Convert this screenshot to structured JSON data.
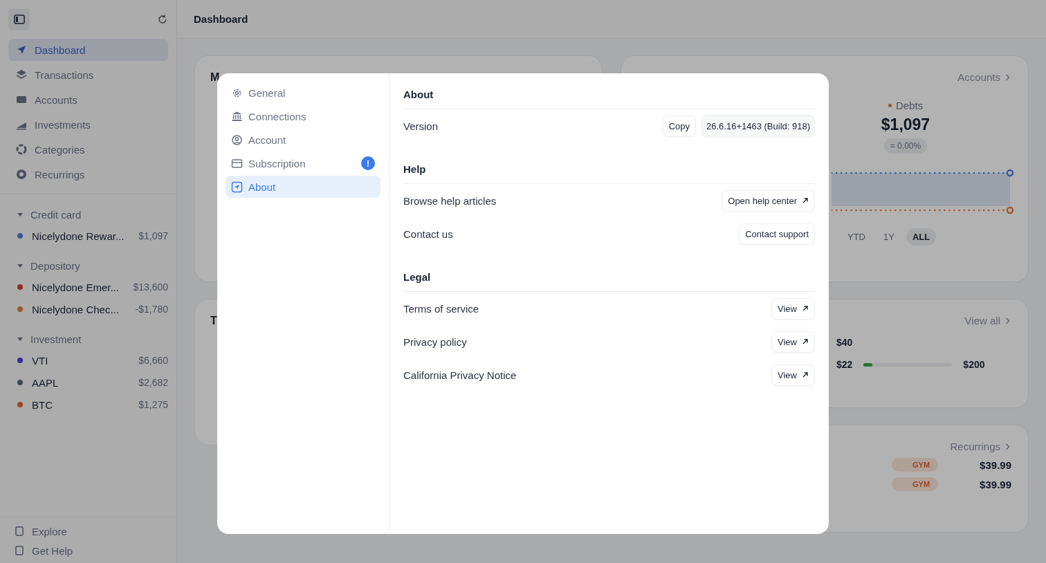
{
  "sidebar": {
    "nav": [
      {
        "label": "Dashboard",
        "selected": true
      },
      {
        "label": "Transactions",
        "selected": false
      },
      {
        "label": "Accounts",
        "selected": false
      },
      {
        "label": "Investments",
        "selected": false
      },
      {
        "label": "Categories",
        "selected": false
      },
      {
        "label": "Recurrings",
        "selected": false
      }
    ],
    "groups": [
      {
        "name": "Credit card",
        "expanded": true,
        "accounts": [
          {
            "name": "Nicelydone Rewar...",
            "amount": "$1,097",
            "color": "#34589d"
          }
        ]
      },
      {
        "name": "Depository",
        "expanded": true,
        "accounts": [
          {
            "name": "Nicelydone Emer...",
            "amount": "$13,600",
            "color": "#97281e"
          },
          {
            "name": "Nicelydone Chec...",
            "amount": "-$1,780",
            "color": "#9d5529"
          }
        ]
      },
      {
        "name": "Investment",
        "expanded": true,
        "accounts": [
          {
            "name": "VTI",
            "amount": "$6,660",
            "color": "#352c96"
          },
          {
            "name": "AAPL",
            "amount": "$2,682",
            "color": "#3f485a"
          },
          {
            "name": "BTC",
            "amount": "$1,275",
            "color": "#9d461e"
          }
        ]
      }
    ],
    "footer": [
      {
        "label": "Explore"
      },
      {
        "label": "Get Help"
      }
    ]
  },
  "header": {
    "title": "Dashboard"
  },
  "cards": {
    "left_titles": [
      "M",
      "T"
    ],
    "accounts_link": "Accounts",
    "debts": {
      "label": "Debts",
      "amount": "$1,097",
      "change": "= 0.00%"
    },
    "ranges": [
      {
        "label": "YTD",
        "selected": false
      },
      {
        "label": "1Y",
        "selected": false
      },
      {
        "label": "ALL",
        "selected": true
      }
    ],
    "budget_link": "View all",
    "budget": {
      "top": "$40",
      "spent": "$22",
      "level": 0.1,
      "limit": "$200"
    },
    "recurrings_link": "Recurrings",
    "recurrings": [
      {
        "tag": "GYM",
        "amount": "$39.99"
      },
      {
        "tag": "GYM",
        "amount": "$39.99"
      }
    ]
  },
  "settings_modal": {
    "nav": [
      {
        "label": "General",
        "selected": false
      },
      {
        "label": "Connections",
        "selected": false
      },
      {
        "label": "Account",
        "selected": false
      },
      {
        "label": "Subscription",
        "selected": false,
        "badge": "!"
      },
      {
        "label": "About",
        "selected": true
      }
    ],
    "sections": [
      {
        "title": "About",
        "rows": [
          {
            "label": "Version",
            "button": "Copy",
            "value": "26.6.16+1463 (Build: 918)",
            "external": false
          }
        ]
      },
      {
        "title": "Help",
        "rows": [
          {
            "label": "Browse help articles",
            "button": "Open help center",
            "external": true
          },
          {
            "label": "Contact us",
            "button": "Contact support",
            "external": false
          }
        ]
      },
      {
        "title": "Legal",
        "rows": [
          {
            "label": "Terms of service",
            "button": "View",
            "external": true
          },
          {
            "label": "Privacy policy",
            "button": "View",
            "external": true
          },
          {
            "label": "California Privacy Notice",
            "button": "View",
            "external": true
          }
        ]
      }
    ]
  }
}
